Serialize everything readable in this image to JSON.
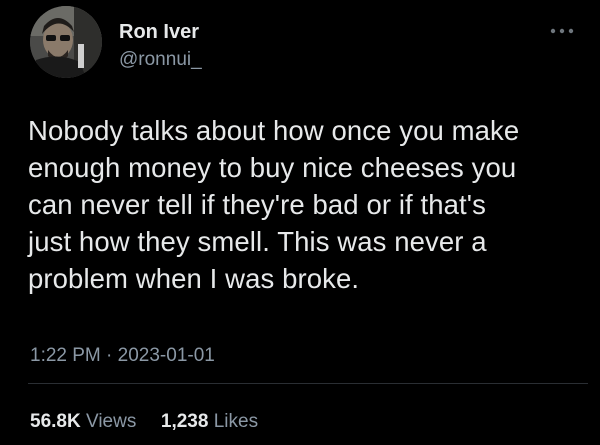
{
  "user": {
    "display_name": "Ron Iver",
    "handle": "@ronnui_"
  },
  "tweet": {
    "text": "Nobody talks about how once you make\nenough money to buy nice cheeses you\ncan never tell if they're bad or if that's\njust how they smell. This was never a\nproblem when I was broke.",
    "time": "1:22 PM",
    "separator": "·",
    "date": "2023-01-01"
  },
  "stats": {
    "views_count": "56.8K",
    "views_label": "Views",
    "likes_count": "1,238",
    "likes_label": "Likes"
  },
  "icons": {
    "more": "more-icon"
  },
  "colors": {
    "background": "#000000",
    "primary_text": "#e7e9ea",
    "secondary_text": "#8b98a5"
  }
}
